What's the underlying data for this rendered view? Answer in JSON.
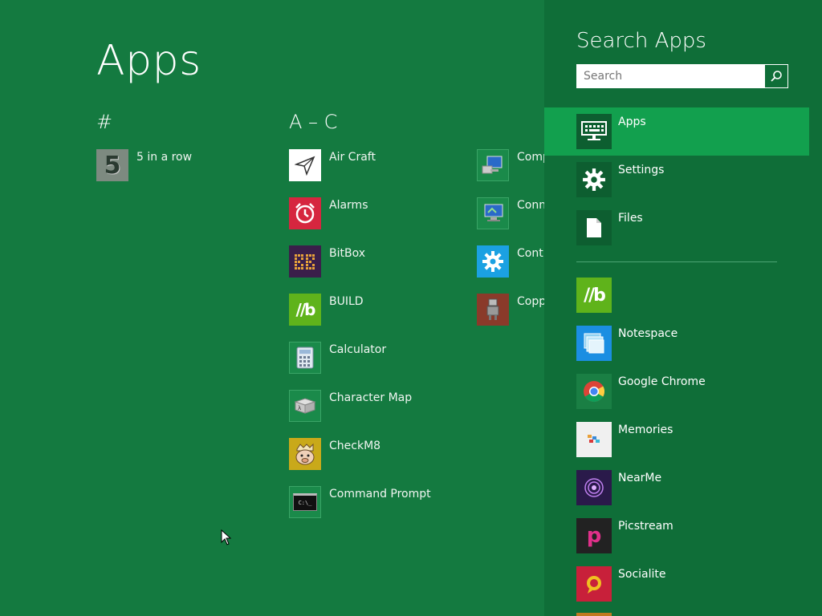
{
  "main": {
    "title": "Apps",
    "groups": [
      {
        "header": "#",
        "apps": [
          {
            "label": "5 in a row",
            "icon": "five-in-a-row-icon"
          }
        ]
      },
      {
        "header": "A – C",
        "apps": [
          {
            "label": "Air Craft",
            "icon": "paper-plane-icon"
          },
          {
            "label": "Alarms",
            "icon": "alarm-clock-icon"
          },
          {
            "label": "BitBox",
            "icon": "bitbox-icon"
          },
          {
            "label": "BUILD",
            "icon": "build-b-icon",
            "tile_text": "//b"
          },
          {
            "label": "Calculator",
            "icon": "calculator-icon"
          },
          {
            "label": "Character Map",
            "icon": "character-map-icon"
          },
          {
            "label": "CheckM8",
            "icon": "checkm8-icon"
          },
          {
            "label": "Command Prompt",
            "icon": "command-prompt-icon",
            "tile_text": "C:\\_"
          }
        ]
      },
      {
        "header": "",
        "apps": [
          {
            "label": "Comp",
            "icon": "computer-icon"
          },
          {
            "label": "Conn",
            "icon": "connection-icon"
          },
          {
            "label": "Contr",
            "icon": "gear-icon"
          },
          {
            "label": "Copp",
            "icon": "robot-icon"
          }
        ]
      }
    ],
    "five_tile_text": "5"
  },
  "pane": {
    "title": "Search Apps",
    "search": {
      "placeholder": "Search",
      "value": ""
    },
    "scopes": [
      {
        "label": "Apps",
        "icon": "keyboard-monitor-icon",
        "selected": true
      },
      {
        "label": "Settings",
        "icon": "gear-icon"
      },
      {
        "label": "Files",
        "icon": "file-icon"
      }
    ],
    "apps": [
      {
        "label": "",
        "icon": "build-b-icon",
        "tile_text": "//b"
      },
      {
        "label": "Notespace",
        "icon": "notespace-icon"
      },
      {
        "label": "Google Chrome",
        "icon": "chrome-icon"
      },
      {
        "label": "Memories",
        "icon": "memories-icon"
      },
      {
        "label": "NearMe",
        "icon": "nearme-icon"
      },
      {
        "label": "Picstream",
        "icon": "picstream-icon",
        "tile_text": "p"
      },
      {
        "label": "Socialite",
        "icon": "socialite-icon"
      }
    ]
  },
  "colors": {
    "background": "#147a40",
    "pane": "#0f6e38",
    "selected": "#12a04e"
  }
}
